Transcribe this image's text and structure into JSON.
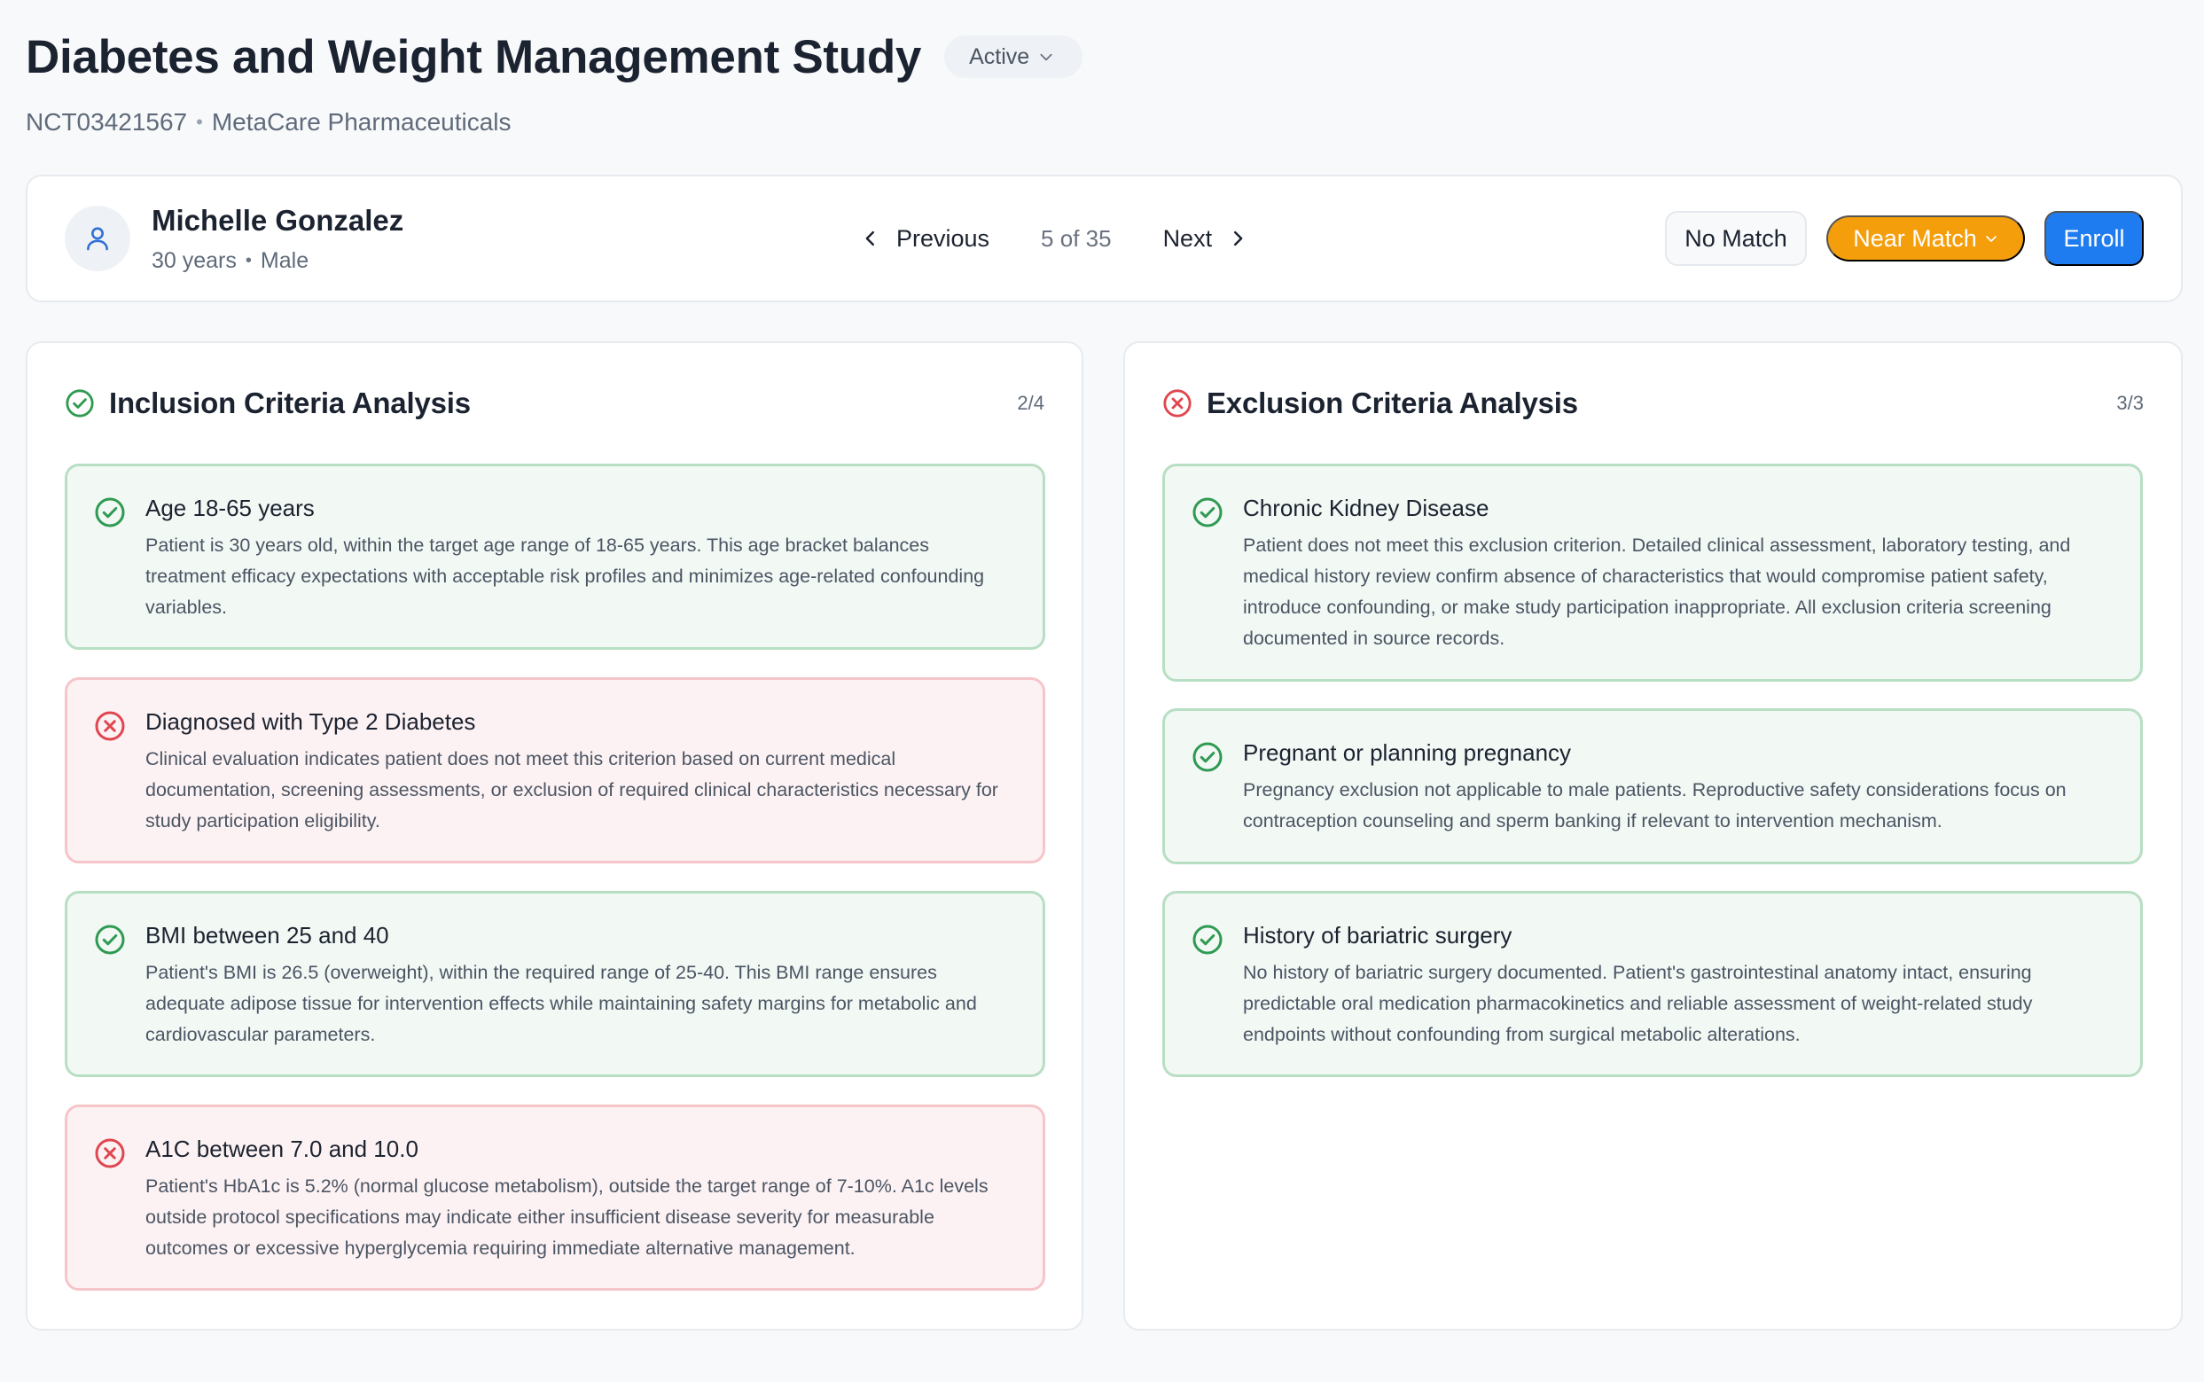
{
  "study": {
    "title": "Diabetes and Weight Management Study",
    "status": "Active",
    "nct_id": "NCT03421567",
    "sponsor": "MetaCare Pharmaceuticals"
  },
  "patient": {
    "name": "Michelle Gonzalez",
    "age": "30 years",
    "sex": "Male"
  },
  "pager": {
    "previous_label": "Previous",
    "count": "5 of 35",
    "next_label": "Next"
  },
  "actions": {
    "no_match": "No Match",
    "near_match": "Near Match",
    "enroll": "Enroll"
  },
  "colors": {
    "pass": "#2f9a52",
    "fail": "#e0464f",
    "near_match": "#f59e0b",
    "enroll": "#1f7cf0"
  },
  "inclusion": {
    "title": "Inclusion Criteria Analysis",
    "count": "2/4",
    "items": [
      {
        "status": "pass",
        "title": "Age 18-65 years",
        "description": "Patient is 30 years old, within the target age range of 18-65 years. This age bracket balances treatment efficacy expectations with acceptable risk profiles and minimizes age-related confounding variables."
      },
      {
        "status": "fail",
        "title": "Diagnosed with Type 2 Diabetes",
        "description": "Clinical evaluation indicates patient does not meet this criterion based on current medical documentation, screening assessments, or exclusion of required clinical characteristics necessary for study participation eligibility."
      },
      {
        "status": "pass",
        "title": "BMI between 25 and 40",
        "description": "Patient's BMI is 26.5 (overweight), within the required range of 25-40. This BMI range ensures adequate adipose tissue for intervention effects while maintaining safety margins for metabolic and cardiovascular parameters."
      },
      {
        "status": "fail",
        "title": "A1C between 7.0 and 10.0",
        "description": "Patient's HbA1c is 5.2% (normal glucose metabolism), outside the target range of 7-10%. A1c levels outside protocol specifications may indicate either insufficient disease severity for measurable outcomes or excessive hyperglycemia requiring immediate alternative management."
      }
    ]
  },
  "exclusion": {
    "title": "Exclusion Criteria Analysis",
    "count": "3/3",
    "items": [
      {
        "status": "pass",
        "title": "Chronic Kidney Disease",
        "description": "Patient does not meet this exclusion criterion. Detailed clinical assessment, laboratory testing, and medical history review confirm absence of characteristics that would compromise patient safety, introduce confounding, or make study participation inappropriate. All exclusion criteria screening documented in source records."
      },
      {
        "status": "pass",
        "title": "Pregnant or planning pregnancy",
        "description": "Pregnancy exclusion not applicable to male patients. Reproductive safety considerations focus on contraception counseling and sperm banking if relevant to intervention mechanism."
      },
      {
        "status": "pass",
        "title": "History of bariatric surgery",
        "description": "No history of bariatric surgery documented. Patient's gastrointestinal anatomy intact, ensuring predictable oral medication pharmacokinetics and reliable assessment of weight-related study endpoints without confounding from surgical metabolic alterations."
      }
    ]
  }
}
